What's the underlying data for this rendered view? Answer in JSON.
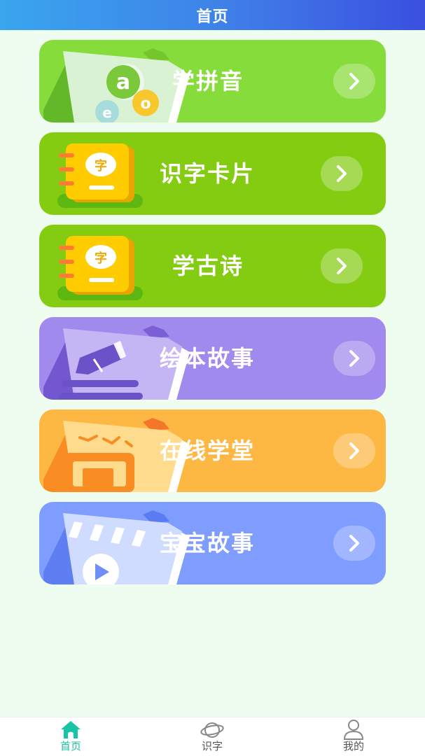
{
  "header": {
    "title": "首页"
  },
  "cards": [
    {
      "label": "学拼音",
      "color": "#86dc3a"
    },
    {
      "label": "识字卡片",
      "color": "#84cc12"
    },
    {
      "label": "学古诗",
      "color": "#84cc12"
    },
    {
      "label": "绘本故事",
      "color": "#a08aee"
    },
    {
      "label": "在线学堂",
      "color": "#fdb843"
    },
    {
      "label": "宝宝故事",
      "color": "#7f9cff"
    }
  ],
  "illustrations": {
    "pinyin_letters": [
      "a",
      "o",
      "e"
    ],
    "card_char": "字"
  },
  "tabbar": {
    "tabs": [
      {
        "label": "首页",
        "icon": "home-icon",
        "active": true
      },
      {
        "label": "识字",
        "icon": "planet-icon",
        "active": false
      },
      {
        "label": "我的",
        "icon": "user-icon",
        "active": false
      }
    ],
    "active_color": "#18c3a6"
  }
}
